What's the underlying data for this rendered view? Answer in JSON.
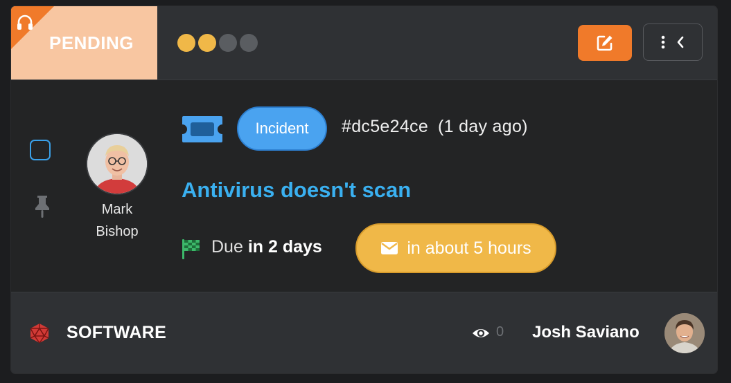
{
  "header": {
    "status_label": "PENDING",
    "priority": {
      "filled": 2,
      "total": 4
    }
  },
  "ticket": {
    "type": "Incident",
    "id": "#dc5e24ce",
    "age": "(1 day ago)",
    "title": "Antivirus doesn't scan",
    "due_prefix": "Due",
    "due_value": "in 2 days",
    "sla": "in about 5 hours"
  },
  "assignee": {
    "first_name": "Mark",
    "last_name": "Bishop"
  },
  "footer": {
    "category": "SOFTWARE",
    "views": "0",
    "agent": "Josh Saviano"
  },
  "colors": {
    "accent_orange": "#f07a2a",
    "status_bg": "#f8c6a1",
    "priority_on": "#f0b848",
    "priority_off": "#5a5d61",
    "type_blue": "#4aa3f0",
    "title_blue": "#3ab0f0",
    "sla_yellow": "#f0b848"
  },
  "icons": {
    "status": "headset-icon",
    "edit": "edit-icon",
    "menu": "kebab-icon",
    "collapse": "chevron-left-icon",
    "pin": "pin-icon",
    "ticket": "ticket-icon",
    "due": "checkered-flag-icon",
    "sla": "envelope-icon",
    "category": "d20-icon",
    "views": "eye-icon"
  }
}
